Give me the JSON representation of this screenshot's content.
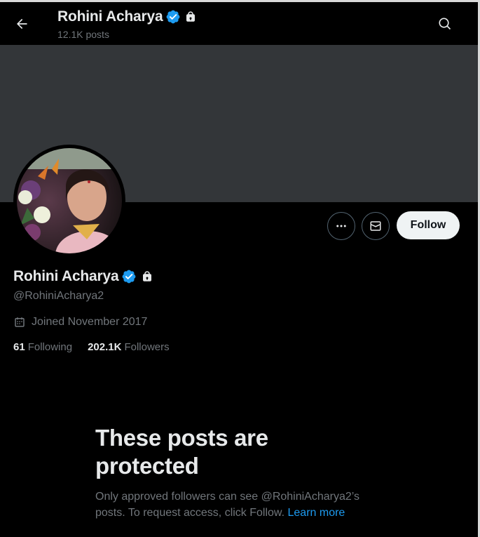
{
  "header": {
    "name": "Rohini Acharya",
    "posts_count": "12.1K posts",
    "icons": [
      "back-arrow-icon",
      "verified-badge-icon",
      "lock-icon",
      "search-icon"
    ]
  },
  "profile": {
    "name": "Rohini Acharya",
    "handle": "@RohiniAcharya2",
    "joined": "Joined November 2017",
    "following_count": "61",
    "following_label": "Following",
    "followers_count": "202.1K",
    "followers_label": "Followers"
  },
  "actions": {
    "more_icon": "more-icon",
    "message_icon": "mail-icon",
    "follow_label": "Follow"
  },
  "protected": {
    "title": "These posts are protected",
    "body": "Only approved followers can see @RohiniAcharya2’s posts. To request access, click Follow.",
    "learn_more": "Learn more"
  },
  "colors": {
    "background": "#000000",
    "banner": "#333639",
    "verified": "#1d9bf0",
    "link": "#1d9bf0",
    "muted_text": "#71767b"
  }
}
